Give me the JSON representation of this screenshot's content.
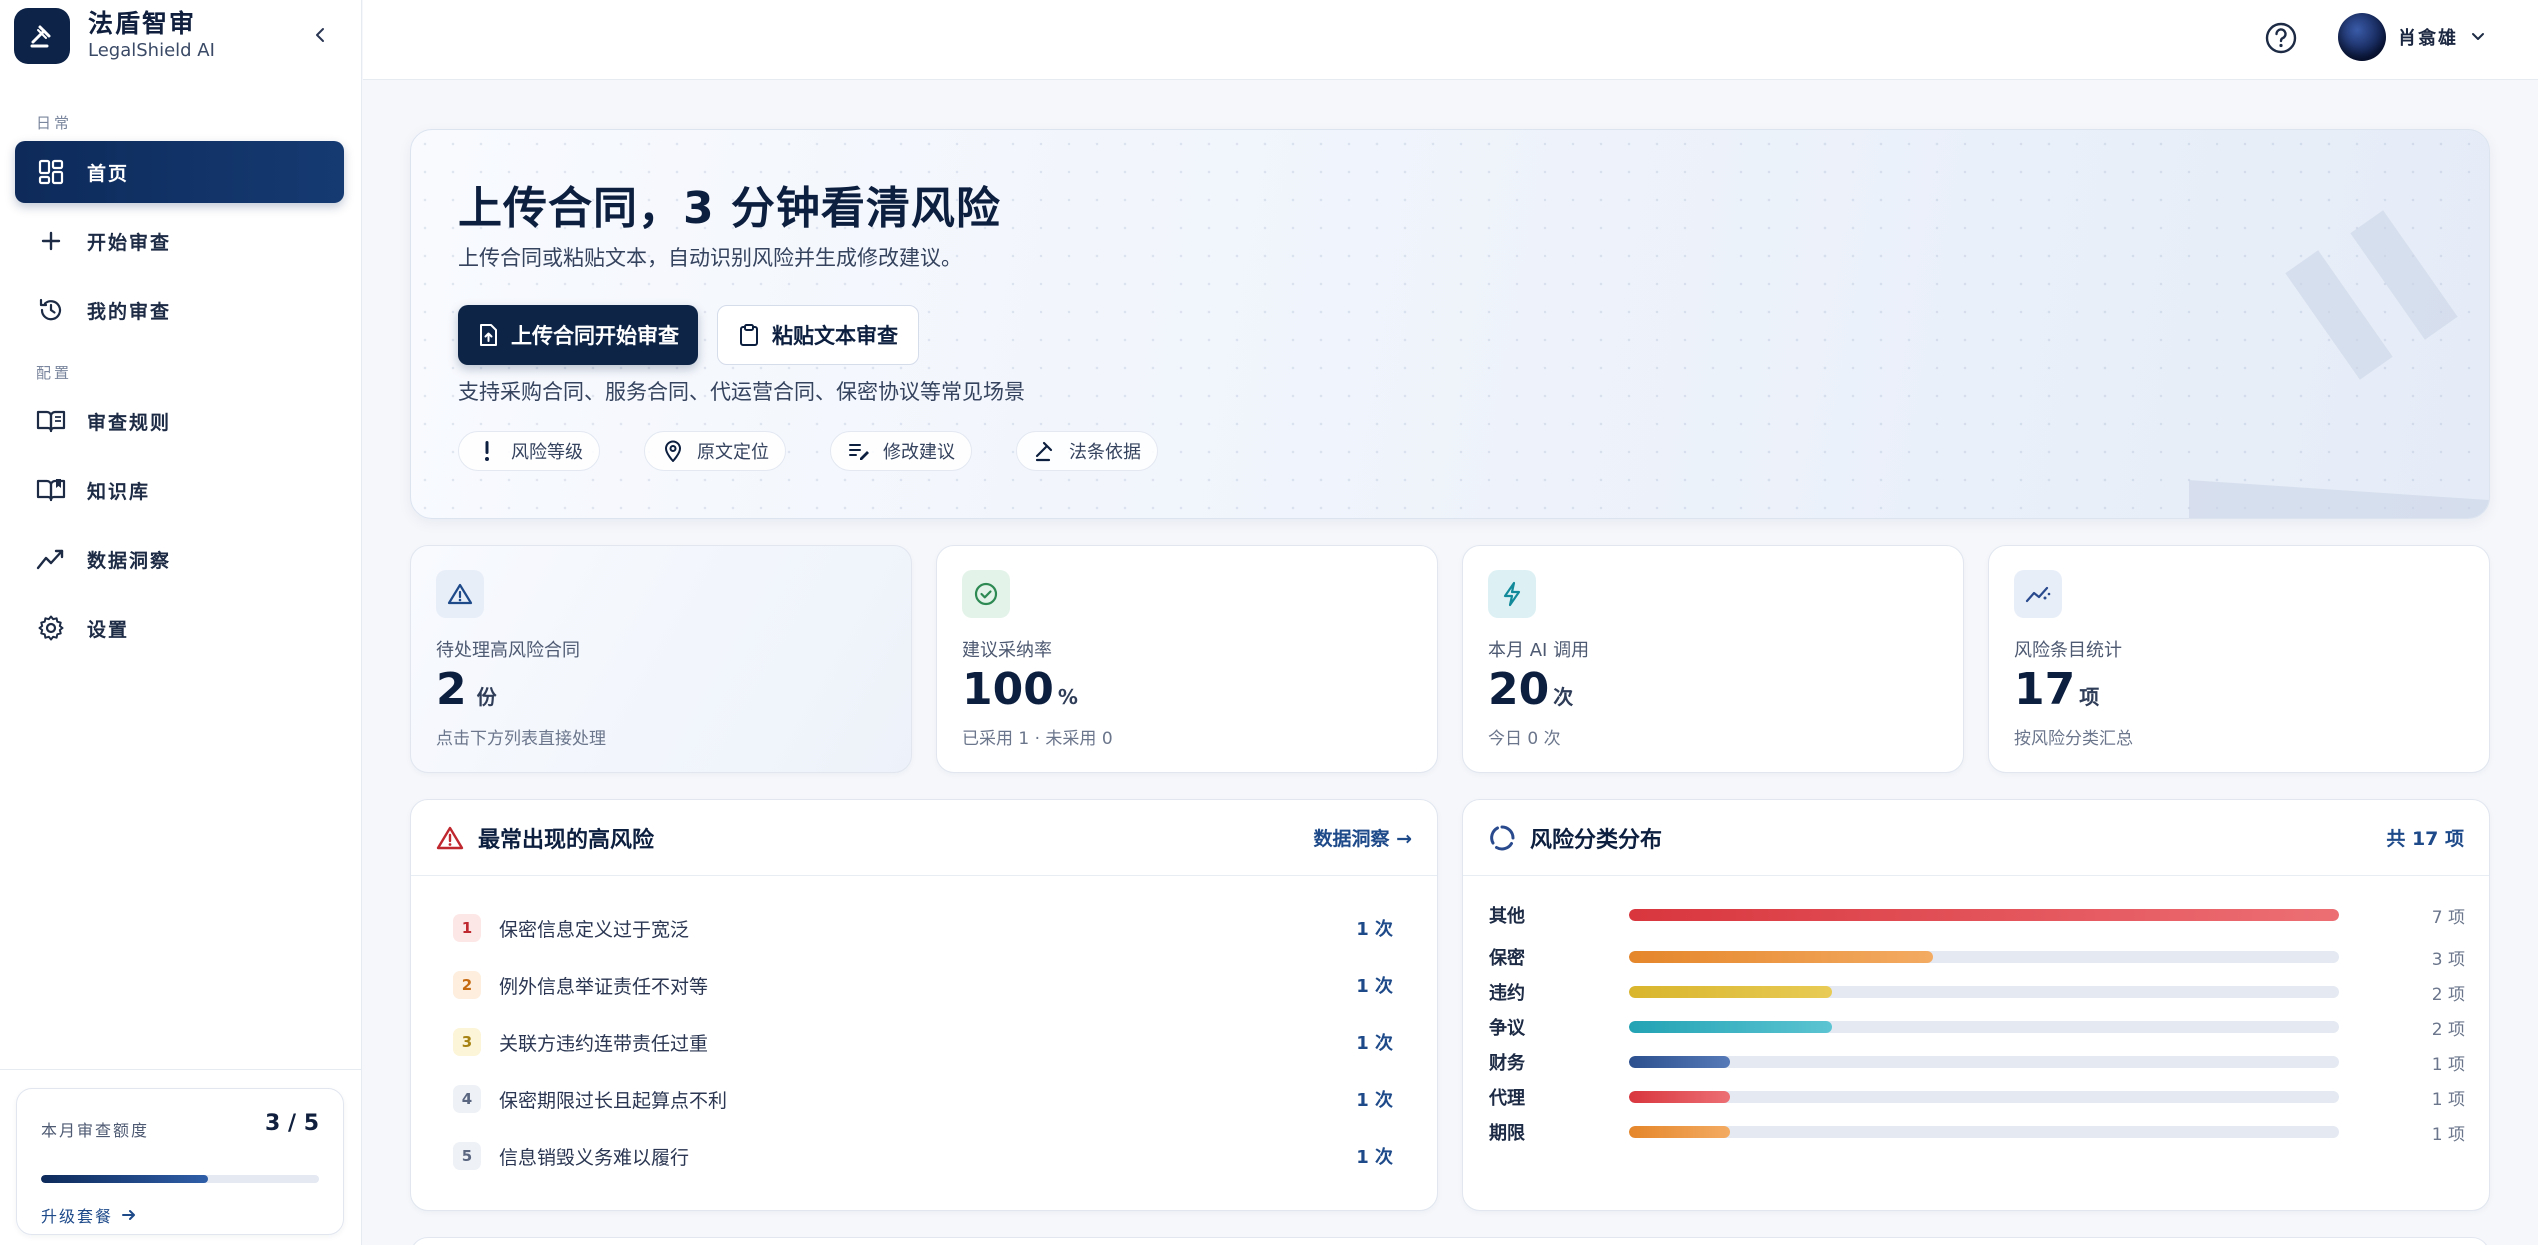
{
  "brand": {
    "title": "法盾智审",
    "subtitle": "LegalShield AI"
  },
  "sidebar": {
    "section_daily": "日常",
    "section_config": "配置",
    "items": [
      {
        "label": "首页",
        "icon": "dashboard-icon",
        "active": true
      },
      {
        "label": "开始审查",
        "icon": "plus-icon"
      },
      {
        "label": "我的审查",
        "icon": "history-icon"
      },
      {
        "label": "审查规则",
        "icon": "book-icon"
      },
      {
        "label": "知识库",
        "icon": "library-icon"
      },
      {
        "label": "数据洞察",
        "icon": "trend-icon"
      },
      {
        "label": "设置",
        "icon": "gear-icon"
      }
    ],
    "quota": {
      "label": "本月审查额度",
      "value": "3 / 5",
      "used": 3,
      "total": 5,
      "upgrade": "升级套餐"
    }
  },
  "topbar": {
    "user_name": "肖翕雄"
  },
  "hero": {
    "title": "上传合同，3 分钟看清风险",
    "subtitle": "上传合同或粘贴文本，自动识别风险并生成修改建议。",
    "primary_button": "上传合同开始审查",
    "secondary_button": "粘贴文本审查",
    "support": "支持采购合同、服务合同、代运营合同、保密协议等常见场景",
    "chips": [
      "风险等级",
      "原文定位",
      "修改建议",
      "法条依据"
    ]
  },
  "stats": [
    {
      "label": "待处理高风险合同",
      "value": "2",
      "unit": "份",
      "note": "点击下方列表直接处理",
      "icon": "warning-icon",
      "color": "#1e4a8a",
      "bg": "#e8eef8"
    },
    {
      "label": "建议采纳率",
      "value": "100",
      "unit": "%",
      "note": "已采用 1 · 未采用 0",
      "icon": "check-circle-icon",
      "color": "#2e8a53",
      "bg": "#e3f3e9"
    },
    {
      "label": "本月 AI 调用",
      "value": "20",
      "unit": "次",
      "note": "今日 0 次",
      "icon": "bolt-icon",
      "color": "#138a9a",
      "bg": "#ddf1f4"
    },
    {
      "label": "风险条目统计",
      "value": "17",
      "unit": "项",
      "note": "按风险分类汇总",
      "icon": "sparkline-icon",
      "color": "#2a4a8e",
      "bg": "#e8eef8"
    }
  ],
  "top_risks": {
    "title": "最常出现的高风险",
    "link": "数据洞察 →",
    "items": [
      {
        "rank": "1",
        "text": "保密信息定义过于宽泛",
        "count": "1 次"
      },
      {
        "rank": "2",
        "text": "例外信息举证责任不对等",
        "count": "1 次"
      },
      {
        "rank": "3",
        "text": "关联方违约连带责任过重",
        "count": "1 次"
      },
      {
        "rank": "4",
        "text": "保密期限过长且起算点不利",
        "count": "1 次"
      },
      {
        "rank": "5",
        "text": "信息销毁义务难以履行",
        "count": "1 次"
      }
    ]
  },
  "distribution": {
    "title": "风险分类分布",
    "total": "共 17 项",
    "items": [
      {
        "name": "其他",
        "value": 7,
        "count": "7 项",
        "color_a": "#d9363e",
        "color_b": "#ec6f74"
      },
      {
        "name": "保密",
        "value": 3,
        "count": "3 项",
        "color_a": "#e5862a",
        "color_b": "#f3ab62"
      },
      {
        "name": "违约",
        "value": 2,
        "count": "2 项",
        "color_a": "#d9b52c",
        "color_b": "#e8cb55"
      },
      {
        "name": "争议",
        "value": 2,
        "count": "2 项",
        "color_a": "#22a3b4",
        "color_b": "#5cc4d2"
      },
      {
        "name": "财务",
        "value": 1,
        "count": "1 项",
        "color_a": "#2c4f8e",
        "color_b": "#5679b8"
      },
      {
        "name": "代理",
        "value": 1,
        "count": "1 项",
        "color_a": "#d9363e",
        "color_b": "#ec6f74"
      },
      {
        "name": "期限",
        "value": 1,
        "count": "1 项",
        "color_a": "#e5862a",
        "color_b": "#f3ab62"
      }
    ]
  }
}
